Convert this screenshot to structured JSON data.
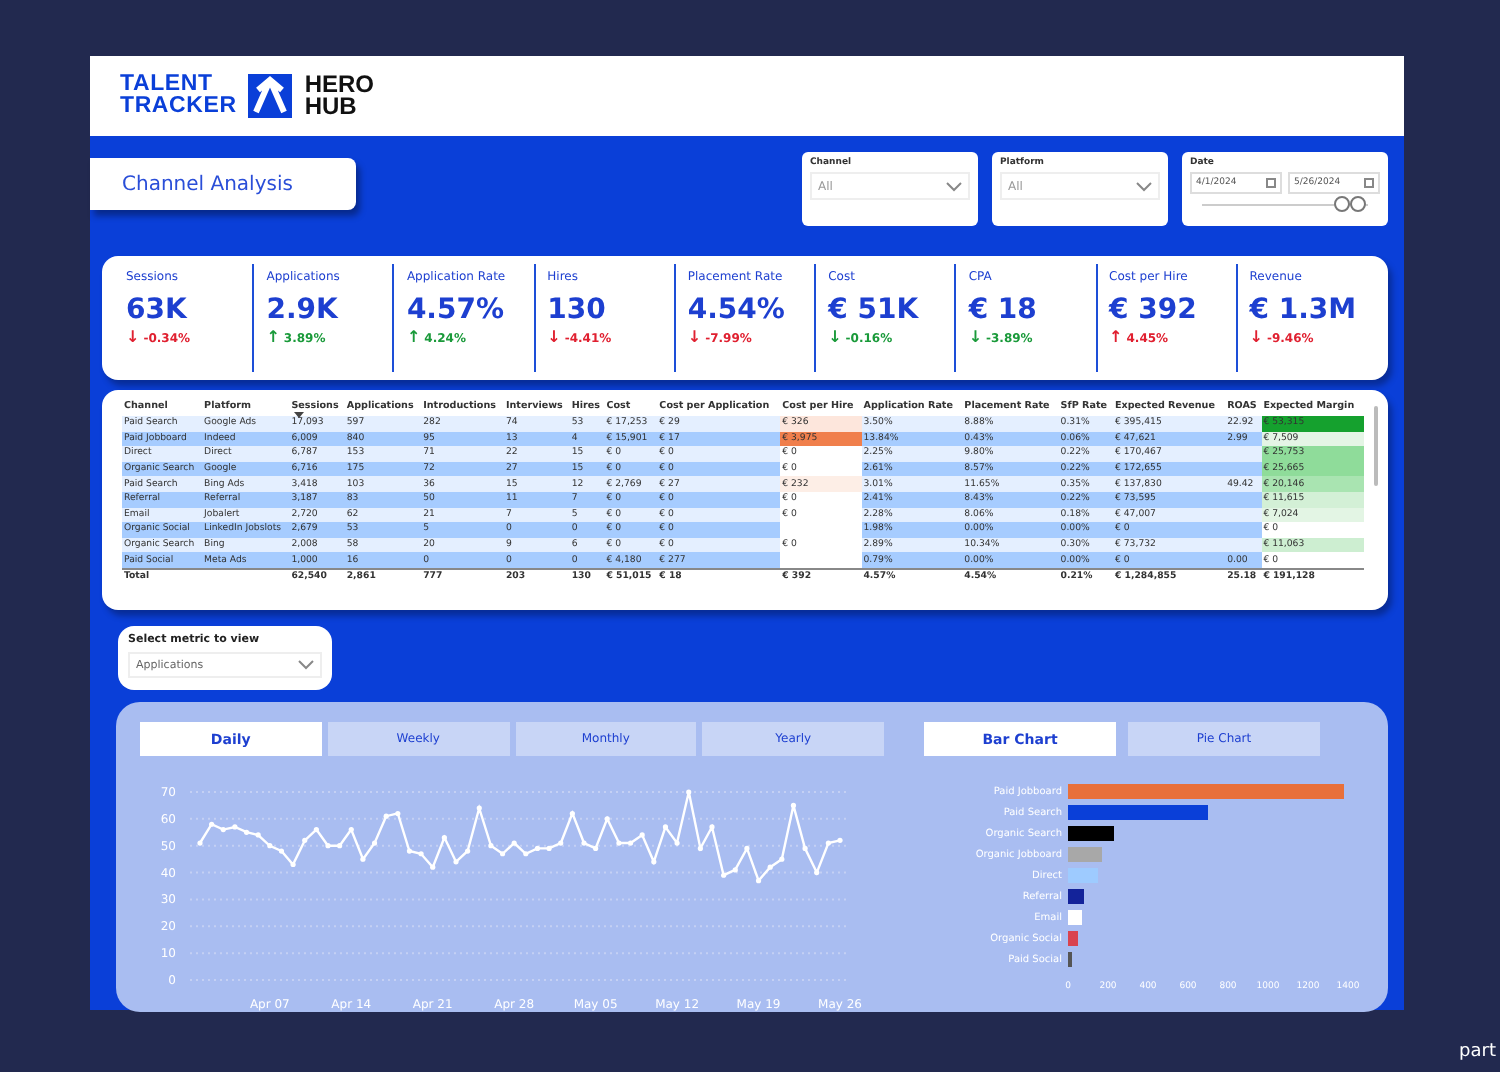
{
  "header": {
    "brand": [
      "TALENT",
      "TRACKER"
    ],
    "partner": [
      "HERO",
      "HUB"
    ]
  },
  "page_button": {
    "label": "Channel Analysis"
  },
  "filters": [
    {
      "label": "Channel",
      "value": "All"
    },
    {
      "label": "Platform",
      "value": "All"
    }
  ],
  "date_filter": {
    "label": "Date",
    "start": "4/1/2024",
    "end": "5/26/2024"
  },
  "kpis": [
    {
      "label": "Sessions",
      "value": "63K",
      "change": "-0.34%",
      "arrow": "↓",
      "good": false
    },
    {
      "label": "Applications",
      "value": "2.9K",
      "change": "3.89%",
      "arrow": "↑",
      "good": true
    },
    {
      "label": "Application Rate",
      "value": "4.57%",
      "change": "4.24%",
      "arrow": "↑",
      "good": true
    },
    {
      "label": "Hires",
      "value": "130",
      "change": "-4.41%",
      "arrow": "↓",
      "good": false
    },
    {
      "label": "Placement Rate",
      "value": "4.54%",
      "change": "-7.99%",
      "arrow": "↓",
      "good": false
    },
    {
      "label": "Cost",
      "value": "€ 51K",
      "change": "-0.16%",
      "arrow": "↓",
      "good": true
    },
    {
      "label": "CPA",
      "value": "€ 18",
      "change": "-3.89%",
      "arrow": "↓",
      "good": true
    },
    {
      "label": "Cost per Hire",
      "value": "€ 392",
      "change": "4.45%",
      "arrow": "↑",
      "good": false
    },
    {
      "label": "Revenue",
      "value": "€ 1.3M",
      "change": "-9.46%",
      "arrow": "↓",
      "good": false
    }
  ],
  "table": {
    "columns": [
      "Channel",
      "Platform",
      "Sessions",
      "Applications",
      "Introductions",
      "Interviews",
      "Hires",
      "Cost",
      "Cost per Application",
      "Cost per Hire",
      "Application Rate",
      "Placement Rate",
      "SfP Rate",
      "Expected Revenue",
      "ROAS",
      "Expected Margin"
    ],
    "rows": [
      {
        "cells": [
          "Paid Search",
          "Google Ads",
          "17,093",
          "597",
          "282",
          "74",
          "53",
          "€ 17,253",
          "€ 29",
          {
            "text": "€ 326",
            "color": "#fde6dc"
          },
          "3.50%",
          "8.88%",
          "0.31%",
          "€ 395,415",
          "22.92",
          {
            "text": "€ 53,315",
            "color": "#15a12e"
          }
        ]
      },
      {
        "cells": [
          "Paid Jobboard",
          "Indeed",
          "6,009",
          "840",
          "95",
          "13",
          "4",
          "€ 15,901",
          "€ 17",
          {
            "text": "€ 3,975",
            "color": "#f07f4c"
          },
          "13.84%",
          "0.43%",
          "0.06%",
          "€ 47,621",
          "2.99",
          {
            "text": "€ 7,509",
            "color": "#e4f5e5"
          }
        ]
      },
      {
        "cells": [
          "Direct",
          "Direct",
          "6,787",
          "153",
          "71",
          "22",
          "15",
          "€ 0",
          "€ 0",
          {
            "text": "€ 0",
            "color": "#ffffff"
          },
          "2.25%",
          "9.80%",
          "0.22%",
          "€ 170,467",
          null,
          {
            "text": "€ 25,753",
            "color": "#8fdc9a"
          }
        ]
      },
      {
        "cells": [
          "Organic Search",
          "Google",
          "6,716",
          "175",
          "72",
          "27",
          "15",
          "€ 0",
          "€ 0",
          {
            "text": "€ 0",
            "color": "#ffffff"
          },
          "2.61%",
          "8.57%",
          "0.22%",
          "€ 172,655",
          null,
          {
            "text": "€ 25,665",
            "color": "#8fdc9a"
          }
        ]
      },
      {
        "cells": [
          "Paid Search",
          "Bing Ads",
          "3,418",
          "103",
          "36",
          "15",
          "12",
          "€ 2,769",
          "€ 27",
          {
            "text": "€ 232",
            "color": "#fdeee6"
          },
          "3.01%",
          "11.65%",
          "0.35%",
          "€ 137,830",
          "49.42",
          {
            "text": "€ 20,146",
            "color": "#a9e4b1"
          }
        ]
      },
      {
        "cells": [
          "Referral",
          "Referral",
          "3,187",
          "83",
          "50",
          "11",
          "7",
          "€ 0",
          "€ 0",
          {
            "text": "€ 0",
            "color": "#ffffff"
          },
          "2.41%",
          "8.43%",
          "0.22%",
          "€ 73,595",
          null,
          {
            "text": "€ 11,615",
            "color": "#d3f0d6"
          }
        ]
      },
      {
        "cells": [
          "Email",
          "Jobalert",
          "2,720",
          "62",
          "21",
          "7",
          "5",
          "€ 0",
          "€ 0",
          {
            "text": "€ 0",
            "color": "#ffffff"
          },
          "2.28%",
          "8.06%",
          "0.18%",
          "€ 47,007",
          null,
          {
            "text": "€ 7,024",
            "color": "#e3f5e4"
          }
        ]
      },
      {
        "cells": [
          "Organic Social",
          "LinkedIn Jobslots",
          "2,679",
          "53",
          "5",
          "0",
          "0",
          "€ 0",
          "€ 0",
          {
            "color": "#ffffff"
          },
          "1.98%",
          "0.00%",
          "0.00%",
          "€ 0",
          null,
          {
            "text": "€ 0",
            "color": "#ffffff"
          }
        ]
      },
      {
        "cells": [
          "Organic Search",
          "Bing",
          "2,008",
          "58",
          "20",
          "9",
          "6",
          "€ 0",
          "€ 0",
          {
            "text": "€ 0",
            "color": "#ffffff"
          },
          "2.89%",
          "10.34%",
          "0.30%",
          "€ 73,732",
          null,
          {
            "text": "€ 11,063",
            "color": "#cdeed1"
          }
        ]
      },
      {
        "cells": [
          "Paid Social",
          "Meta Ads",
          "1,000",
          "16",
          "0",
          "0",
          "0",
          "€ 4,180",
          "€ 277",
          {
            "color": "#ffffff"
          },
          "0.79%",
          "0.00%",
          "0.00%",
          "€ 0",
          "0.00",
          {
            "text": "€ 0",
            "color": "#ffffff"
          }
        ]
      }
    ],
    "total": {
      "label": "Total",
      "cells": [
        "62,540",
        "2,861",
        "777",
        "203",
        "130",
        "€ 51,015",
        "€ 18",
        "€ 392",
        "4.57%",
        "4.54%",
        "0.21%",
        "€ 1,284,855",
        "25.18",
        "€ 191,128"
      ]
    }
  },
  "metric_select": {
    "label": "Select metric to view",
    "value": "Applications"
  },
  "period_tabs": [
    {
      "label": "Daily",
      "selected": true
    },
    {
      "label": "Weekly",
      "selected": false
    },
    {
      "label": "Monthly",
      "selected": false
    },
    {
      "label": "Yearly",
      "selected": false
    }
  ],
  "chart_tabs": [
    {
      "label": "Bar Chart",
      "selected": true
    },
    {
      "label": "Pie Chart",
      "selected": false
    }
  ],
  "line_chart": {
    "chart_data": {
      "type": "line",
      "grid": true,
      "ylim": [
        0,
        70
      ],
      "yticks": [
        0,
        10,
        20,
        30,
        40,
        50,
        60,
        70
      ],
      "categories": [
        null,
        null,
        null,
        null,
        null,
        null,
        "Apr 07",
        null,
        null,
        null,
        null,
        null,
        null,
        "Apr 14",
        null,
        null,
        null,
        null,
        null,
        null,
        "Apr 21",
        null,
        null,
        null,
        null,
        null,
        null,
        "Apr 28",
        null,
        null,
        null,
        null,
        null,
        null,
        "May 05",
        null,
        null,
        null,
        null,
        null,
        null,
        "May 12",
        null,
        null,
        null,
        null,
        null,
        null,
        "May 19",
        null,
        null,
        null,
        null,
        null,
        null,
        "May 26"
      ],
      "series": [
        {
          "color": "#ffffff",
          "values": [
            51,
            58,
            56,
            57,
            55,
            54,
            50,
            48,
            43,
            52,
            56,
            50,
            50,
            56,
            45,
            51,
            61,
            62,
            48,
            47,
            42,
            53,
            44,
            48,
            64,
            50,
            47,
            51,
            47,
            49,
            49,
            51,
            62,
            51,
            49,
            60,
            51,
            51,
            54,
            44,
            57,
            51,
            70,
            49,
            57,
            39,
            41,
            49,
            37,
            42,
            45,
            65,
            49,
            40,
            51,
            52
          ]
        }
      ]
    }
  },
  "bar_chart": {
    "chart_data": {
      "type": "bar",
      "orientation": "horizontal",
      "categories": [
        "Paid Jobboard",
        "Paid Search",
        "Organic Search",
        "Organic Jobboard",
        "Direct",
        "Referral",
        "Email",
        "Organic Social",
        "Paid Social"
      ],
      "xlim": [
        0,
        1400
      ],
      "xticks": [
        0,
        200,
        400,
        600,
        800,
        1000,
        1200,
        1400
      ],
      "series": [
        {
          "values": [
            1380,
            700,
            230,
            170,
            150,
            80,
            70,
            50,
            20
          ]
        }
      ],
      "colors": [
        "#e8703a",
        "#0a3fd8",
        "#000000",
        "#a8a8a8",
        "#9ecbff",
        "#13239a",
        "#ffffff",
        "#d9434f",
        "#555555"
      ]
    }
  },
  "corner_text": "part"
}
